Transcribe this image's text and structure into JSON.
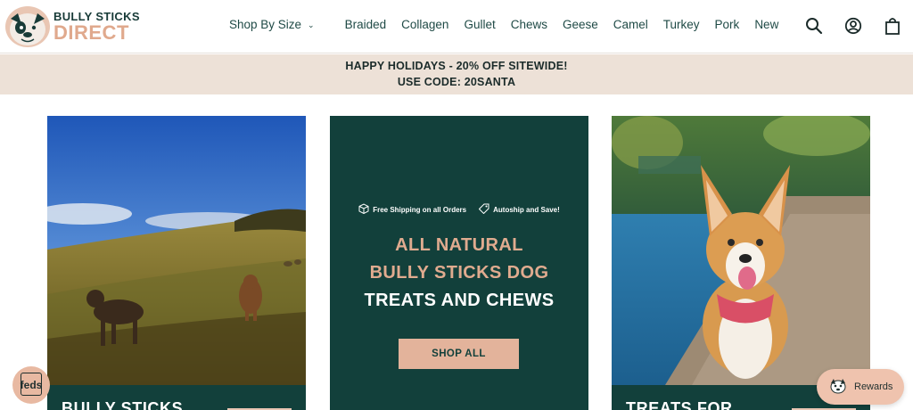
{
  "brand": {
    "line1": "BULLY STICKS",
    "line2": "DIRECT"
  },
  "nav": {
    "items": [
      {
        "label": "Shop By Size",
        "has_dropdown": true
      },
      {
        "label": "Braided"
      },
      {
        "label": "Collagen"
      },
      {
        "label": "Gullet"
      },
      {
        "label": "Chews"
      },
      {
        "label": "Geese"
      },
      {
        "label": "Camel"
      },
      {
        "label": "Turkey"
      },
      {
        "label": "Pork"
      },
      {
        "label": "New"
      }
    ]
  },
  "header_icons": [
    "search-icon",
    "account-icon",
    "cart-icon"
  ],
  "promo": {
    "line1": "HAPPY HOLIDAYS - 20% OFF SITEWIDE!",
    "line2": "USE CODE: 20SANTA"
  },
  "hero": {
    "perk1": "Free Shipping on all Orders",
    "perk2": "Autoship and Save!",
    "headline_line1": "ALL NATURAL",
    "headline_line2": "BULLY STICKS DOG",
    "headline_line3": "TREATS AND CHEWS",
    "cta": "SHOP ALL"
  },
  "cards": {
    "left_title": "BULLY STICKS",
    "right_title": "TREATS FOR"
  },
  "widgets": {
    "feds_label": "feds",
    "rewards_label": "Rewards"
  },
  "colors": {
    "brand_dark": "#12403b",
    "brand_peach": "#e0a98d",
    "promo_bg": "#ede1d7"
  }
}
